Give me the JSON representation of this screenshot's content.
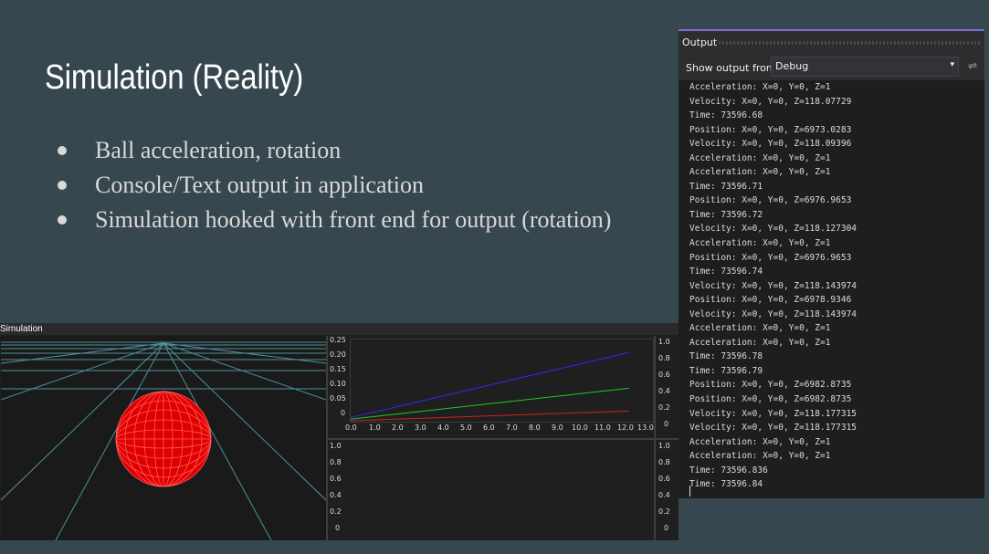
{
  "slide": {
    "title": "Simulation (Reality)",
    "bullets": [
      "Ball acceleration, rotation",
      "Console/Text output in application",
      "Simulation hooked with front end for output (rotation)"
    ]
  },
  "simulation_window": {
    "title": "Simulation",
    "ball_color": "#ff0000",
    "grid_color": "#5ab0bd"
  },
  "charts": {
    "top_plot": {
      "y_ticks": [
        "0.25",
        "0.20",
        "0.15",
        "0.10",
        "0.05",
        "0"
      ],
      "x_ticks": [
        "0.0",
        "1.0",
        "2.0",
        "3.0",
        "4.0",
        "5.0",
        "6.0",
        "7.0",
        "8.0",
        "9.0",
        "10.0",
        "11.0",
        "12.0",
        "13.0"
      ],
      "right_ticks": [
        "1.0",
        "0.8",
        "0.6",
        "0.4",
        "0.2",
        "0"
      ]
    },
    "bottom_plot": {
      "y_ticks": [
        "1.0",
        "0.8",
        "0.6",
        "0.4",
        "0.2",
        "0"
      ],
      "right_ticks": [
        "1.0",
        "0.8",
        "0.6",
        "0.4",
        "0.2",
        "0"
      ]
    }
  },
  "chart_data": {
    "type": "line",
    "x": [
      0,
      12
    ],
    "series": [
      {
        "color": "#2c2cff",
        "values": [
          0.01,
          0.21
        ]
      },
      {
        "color": "#1fcc1f",
        "values": [
          0.005,
          0.1
        ]
      },
      {
        "color": "#d42020",
        "values": [
          0.0,
          0.03
        ]
      }
    ],
    "xlim": [
      0,
      13
    ],
    "ylim": [
      0,
      0.25
    ],
    "grid": false
  },
  "output_panel": {
    "title": "Output",
    "show_output_from_label": "Show output from:",
    "source_value": "Debug",
    "accent_color": "#7d6cd8",
    "lines": [
      "Acceleration: X=0, Y=0, Z=1",
      "Velocity: X=0, Y=0, Z=118.07729",
      "Time: 73596.68",
      "Position: X=0, Y=0, Z=6973.0283",
      "Velocity: X=0, Y=0, Z=118.09396",
      "Acceleration: X=0, Y=0, Z=1",
      "Acceleration: X=0, Y=0, Z=1",
      "Time: 73596.71",
      "Position: X=0, Y=0, Z=6976.9653",
      "Time: 73596.72",
      "Velocity: X=0, Y=0, Z=118.127304",
      "Acceleration: X=0, Y=0, Z=1",
      "Position: X=0, Y=0, Z=6976.9653",
      "Time: 73596.74",
      "Velocity: X=0, Y=0, Z=118.143974",
      "Position: X=0, Y=0, Z=6978.9346",
      "Velocity: X=0, Y=0, Z=118.143974",
      "Acceleration: X=0, Y=0, Z=1",
      "Acceleration: X=0, Y=0, Z=1",
      "Time: 73596.78",
      "Time: 73596.79",
      "Position: X=0, Y=0, Z=6982.8735",
      "Position: X=0, Y=0, Z=6982.8735",
      "Velocity: X=0, Y=0, Z=118.177315",
      "Velocity: X=0, Y=0, Z=118.177315",
      "Acceleration: X=0, Y=0, Z=1",
      "Acceleration: X=0, Y=0, Z=1",
      "Time: 73596.836",
      "Time: 73596.84"
    ]
  }
}
